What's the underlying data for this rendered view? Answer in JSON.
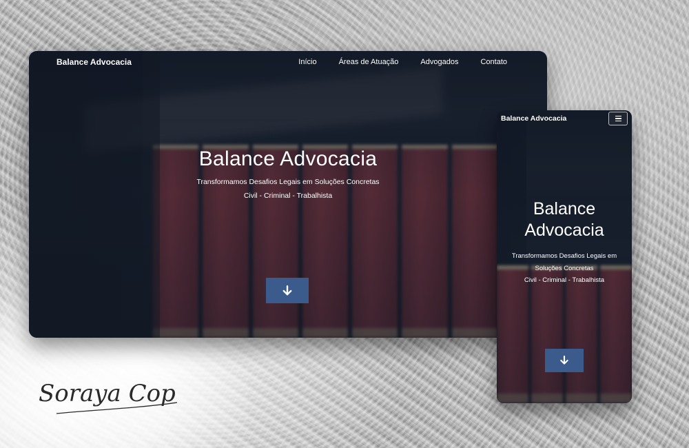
{
  "desktop": {
    "brand": "Balance Advocacia",
    "nav": [
      "Início",
      "Áreas de Atuação",
      "Advogados",
      "Contato"
    ],
    "hero": {
      "title": "Balance Advocacia",
      "subtitle": "Transformamos Desafios Legais em Soluções Concretas",
      "areas": "Civil - Criminal - Trabalhista"
    },
    "scroll_button_icon": "arrow-down-icon"
  },
  "mobile": {
    "brand": "Balance Advocacia",
    "menu_icon": "hamburger-menu-icon",
    "hero": {
      "title": "Balance Advocacia",
      "subtitle": "Transformamos Desafios Legais em Soluções Concretas",
      "areas": "Civil - Criminal - Trabalhista"
    },
    "scroll_button_icon": "arrow-down-icon"
  },
  "signature": "Soraya Cop",
  "colors": {
    "button": "#3b5b8c",
    "overlay": "#101826",
    "book_red": "#8a3b46"
  }
}
